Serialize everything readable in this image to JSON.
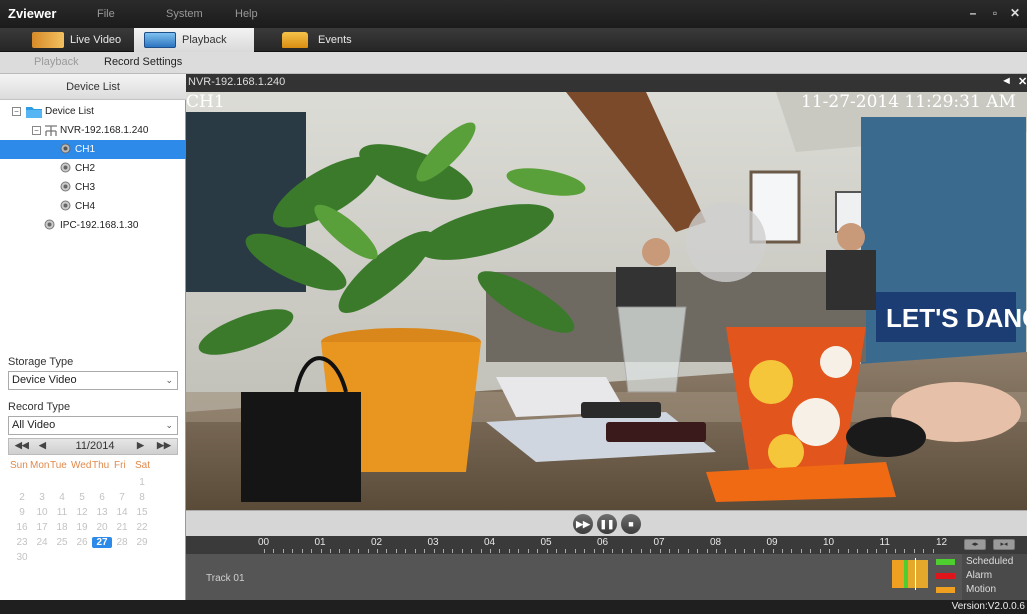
{
  "app": {
    "title": "Zviewer",
    "menu": [
      "File",
      "System",
      "Help"
    ]
  },
  "tabs": [
    "Live Video",
    "Playback",
    "Events"
  ],
  "subtabs": [
    "Playback",
    "Record Settings"
  ],
  "left_panel": {
    "header": "Device List",
    "tree": {
      "root": "Device List",
      "nvr": "NVR-192.168.1.240",
      "channels": [
        "CH1",
        "CH2",
        "CH3",
        "CH4"
      ],
      "ipc": "IPC-192.168.1.30"
    },
    "storage_type_label": "Storage Type",
    "storage_type_value": "Device Video",
    "record_type_label": "Record Type",
    "record_type_value": "All Video",
    "calendar": {
      "month": "11/2014",
      "weekdays": [
        "Sun",
        "Mon",
        "Tue",
        "Wed",
        "Thu",
        "Fri",
        "Sat"
      ],
      "selected_day": "27",
      "days": [
        [
          "",
          "",
          "",
          "",
          "",
          "",
          "1"
        ],
        [
          "2",
          "3",
          "4",
          "5",
          "6",
          "7",
          "8"
        ],
        [
          "9",
          "10",
          "11",
          "12",
          "13",
          "14",
          "15"
        ],
        [
          "16",
          "17",
          "18",
          "19",
          "20",
          "21",
          "22"
        ],
        [
          "23",
          "24",
          "25",
          "26",
          "27",
          "28",
          "29"
        ],
        [
          "30",
          "",
          "",
          "",
          "",
          "",
          ""
        ]
      ]
    }
  },
  "video": {
    "title": "NVR-192.168.1.240",
    "channel_overlay": "CH1",
    "timestamp_overlay": "11-27-2014 11:29:31 AM"
  },
  "timeline": {
    "hours": [
      "00",
      "01",
      "02",
      "03",
      "04",
      "05",
      "06",
      "07",
      "08",
      "09",
      "10",
      "11",
      "12"
    ],
    "track_label": "Track 01",
    "legend": [
      {
        "label": "Scheduled",
        "color": "#4fcf2f"
      },
      {
        "label": "Alarm",
        "color": "#e0141b"
      },
      {
        "label": "Motion",
        "color": "#f0a020"
      }
    ]
  },
  "status": {
    "version": "Version:V2.0.0.6"
  },
  "colors": {
    "accent": "#2d8ae8",
    "calendar_header": "#e08a4c"
  }
}
